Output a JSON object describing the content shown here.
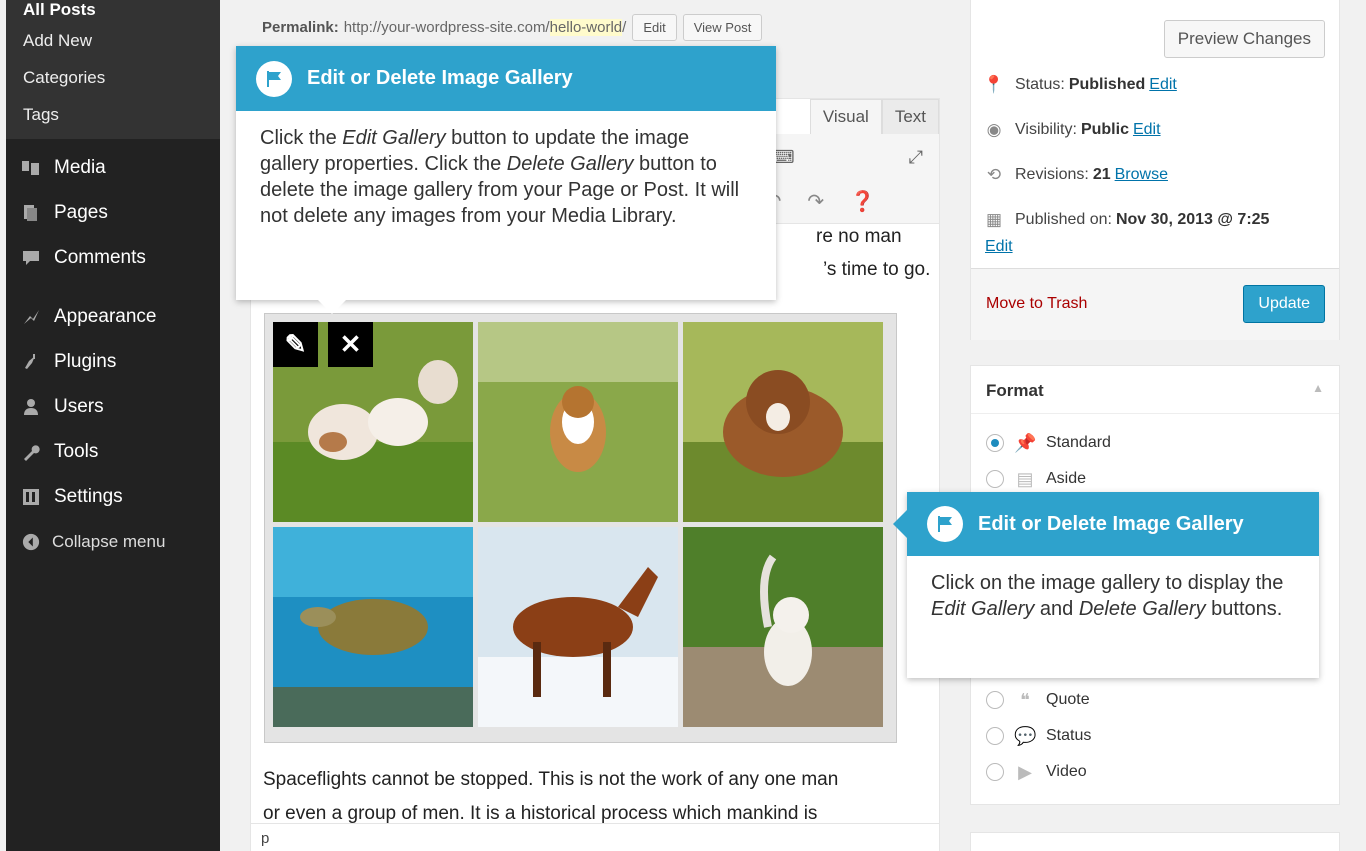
{
  "sidebar": {
    "submenu": [
      "All Posts",
      "Add New",
      "Categories",
      "Tags"
    ],
    "menu": [
      {
        "label": "Media",
        "icon": "media-icon"
      },
      {
        "label": "Pages",
        "icon": "pages-icon"
      },
      {
        "label": "Comments",
        "icon": "comments-icon"
      },
      {
        "label": "Appearance",
        "icon": "appearance-icon"
      },
      {
        "label": "Plugins",
        "icon": "plugins-icon"
      },
      {
        "label": "Users",
        "icon": "users-icon"
      },
      {
        "label": "Tools",
        "icon": "tools-icon"
      },
      {
        "label": "Settings",
        "icon": "settings-icon"
      }
    ],
    "collapse": "Collapse menu"
  },
  "permalink": {
    "label": "Permalink:",
    "base": "http://your-wordpress-site.com/",
    "slug": "hello-world",
    "slash": "/",
    "edit": "Edit",
    "view": "View Post"
  },
  "editor": {
    "tab_visual": "Visual",
    "tab_text": "Text",
    "line1_end": "re no man",
    "line2_end": "’s time to go.",
    "para2_line1": "Spaceflights cannot be stopped. This is not the work of any one man",
    "para2_line2": "or even a group of men. It is a historical process which mankind is",
    "path": "p"
  },
  "pointer_top": {
    "title": "Edit or Delete Image Gallery",
    "t1": "Click the ",
    "t2": "Edit Gallery",
    "t3": " button to update the image gallery properties. Click the ",
    "t4": "Delete Gallery",
    "t5": " button to delete the image gallery from your Page or Post. It will not delete any images from your Media Library."
  },
  "pointer_right": {
    "title": "Edit or Delete Image Gallery",
    "t1": "Click on the image gallery to display the ",
    "t2": "Edit Gallery",
    "t3": " and ",
    "t4": "Delete Gallery",
    "t5": " buttons."
  },
  "publish": {
    "preview": "Preview Changes",
    "status_label": "Status:",
    "status_value": "Published",
    "visibility_label": "Visibility:",
    "visibility_value": "Public",
    "revisions_label": "Revisions:",
    "revisions_value": "21",
    "browse": "Browse",
    "published_label": "Published on:",
    "published_value": "Nov 30, 2013 @ 7:25",
    "edit": "Edit",
    "trash": "Move to Trash",
    "update": "Update"
  },
  "format": {
    "title": "Format",
    "options": [
      "Standard",
      "Aside",
      "Quote",
      "Status",
      "Video"
    ]
  },
  "colors": {
    "accent": "#2ea2cc",
    "menu_bg": "#222222",
    "link": "#0073aa",
    "trash": "#aa0000"
  }
}
